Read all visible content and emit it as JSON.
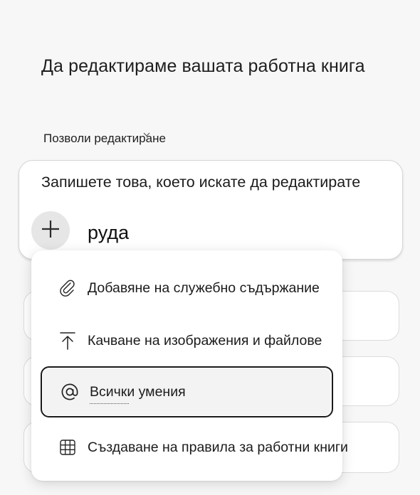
{
  "header": {
    "title": "Да редактираме вашата работна книга"
  },
  "permission": {
    "label": "Позволи редактиране",
    "caret_icon": "chevron-down-icon"
  },
  "prompt": {
    "placeholder": "Запишете това, което искате да редактирате",
    "value": "руда",
    "add_icon": "plus-icon"
  },
  "menu": {
    "items": [
      {
        "label": "Добавяне на служебно съдържание",
        "icon": "paperclip-icon"
      },
      {
        "label": "Качване на изображения и файлове",
        "icon": "upload-icon"
      },
      {
        "label": "Всички умения",
        "icon": "at-sign-icon",
        "selected": true
      },
      {
        "label": "Създаване на правила за работни книги",
        "icon": "grid-icon"
      }
    ]
  }
}
